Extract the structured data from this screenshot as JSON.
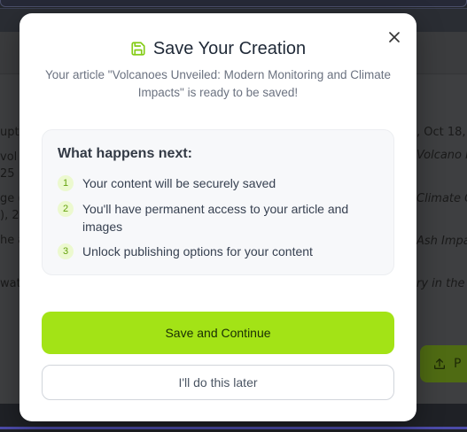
{
  "background": {
    "left_fragments": [
      "upt",
      "vol",
      "25",
      "ge (",
      "), 2(",
      "he a",
      "wat"
    ],
    "right_fragments": [
      ", Oct 18,",
      "Volcano M",
      "Climate C",
      "Ash Impa",
      "ry in the"
    ],
    "publish_button_label": "P"
  },
  "modal": {
    "icon": "save-icon",
    "title": "Save Your Creation",
    "subtitle": "Your article \"Volcanoes Unveiled: Modern Monitoring and Climate Impacts\" is ready to be saved!",
    "close_icon": "close-icon",
    "info": {
      "heading": "What happens next:",
      "steps": [
        {
          "number": "1",
          "text": "Your content will be securely saved"
        },
        {
          "number": "2",
          "text": "You'll have permanent access to your article and images"
        },
        {
          "number": "3",
          "text": "Unlock publishing options for your content"
        }
      ]
    },
    "primary_button": "Save and Continue",
    "secondary_button": "I'll do this later"
  },
  "colors": {
    "accent": "#a3e316",
    "accent_icon": "#84cc16",
    "overlay": "#3e3f41"
  }
}
